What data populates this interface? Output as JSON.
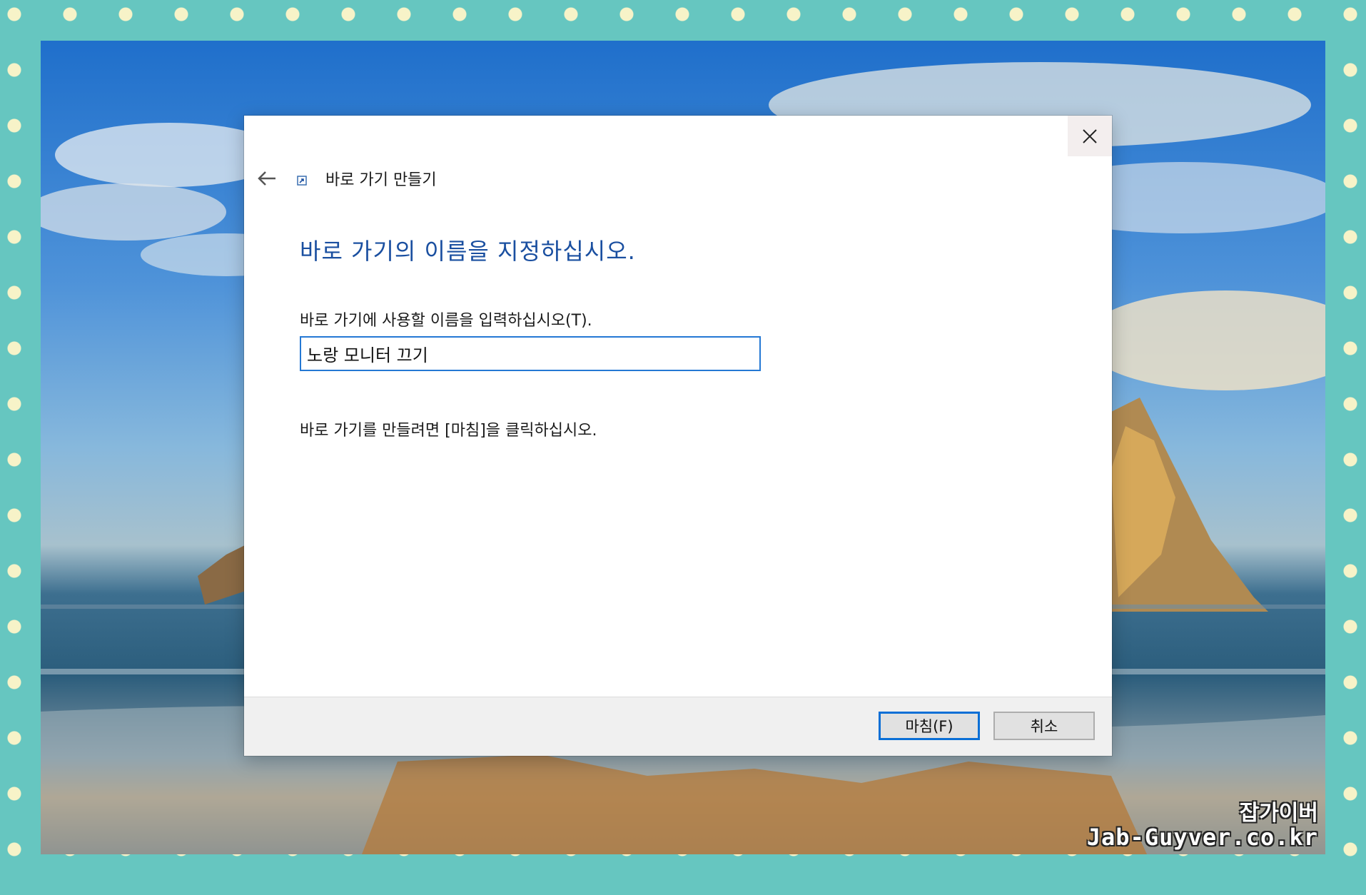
{
  "dialog": {
    "window_title": "바로 가기 만들기",
    "heading": "바로 가기의 이름을 지정하십시오.",
    "name_label": "바로 가기에 사용할 이름을 입력하십시오(T).",
    "name_value": "노랑 모니터 끄기",
    "instruction": "바로 가기를 만들려면 [마침]을 클릭하십시오.",
    "finish_label": "마침(F)",
    "cancel_label": "취소"
  },
  "icons": {
    "back": "back-arrow-icon",
    "close": "close-icon",
    "shortcut": "shortcut-icon"
  },
  "watermark": {
    "line1": "잡가이버",
    "line2": "Jab-Guyver.co.kr"
  },
  "colors": {
    "frame": "#66c6c0",
    "dots": "#f7f3c8",
    "heading": "#1a4fa0",
    "input_border": "#2478d4",
    "finish_border": "#0a6fd6",
    "footer": "#f0f0f0"
  }
}
